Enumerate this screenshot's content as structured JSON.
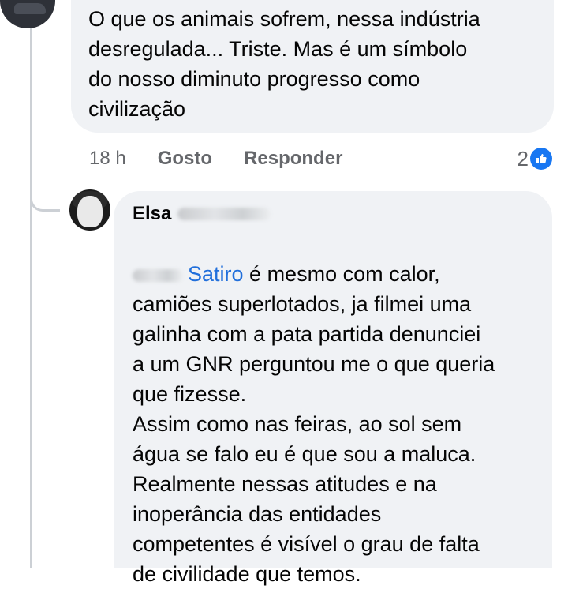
{
  "parent_comment": {
    "text": "O que os animais sofrem, nessa indústria\ndesregulada... Triste. Mas é um símbolo\ndo nosso diminuto progresso como\ncivilização",
    "time": "18 h",
    "like_label": "Gosto",
    "reply_label": "Responder",
    "reaction_count": "2",
    "reaction_icon": "like-icon",
    "reaction_color": "#1877f2"
  },
  "reply_comment": {
    "author": "Elsa",
    "mention": "Satiro",
    "text_first": " é mesmo com calor,",
    "text_rest": "camiões superlotados, ja filmei uma\ngalinha com a pata partida denunciei\na um GNR perguntou me o que queria\nque fizesse.\nAssim como nas feiras, ao sol sem\nágua se falo eu é que sou a maluca.\nRealmente nessas atitudes e na\ninoperância das entidades\ncompetentes é visível o grau de falta\nde civilidade que temos."
  },
  "colors": {
    "bubble": "#f0f2f5",
    "secondary_text": "#65676b",
    "mention": "#216fdb",
    "thread_line": "#ccd0d5"
  }
}
